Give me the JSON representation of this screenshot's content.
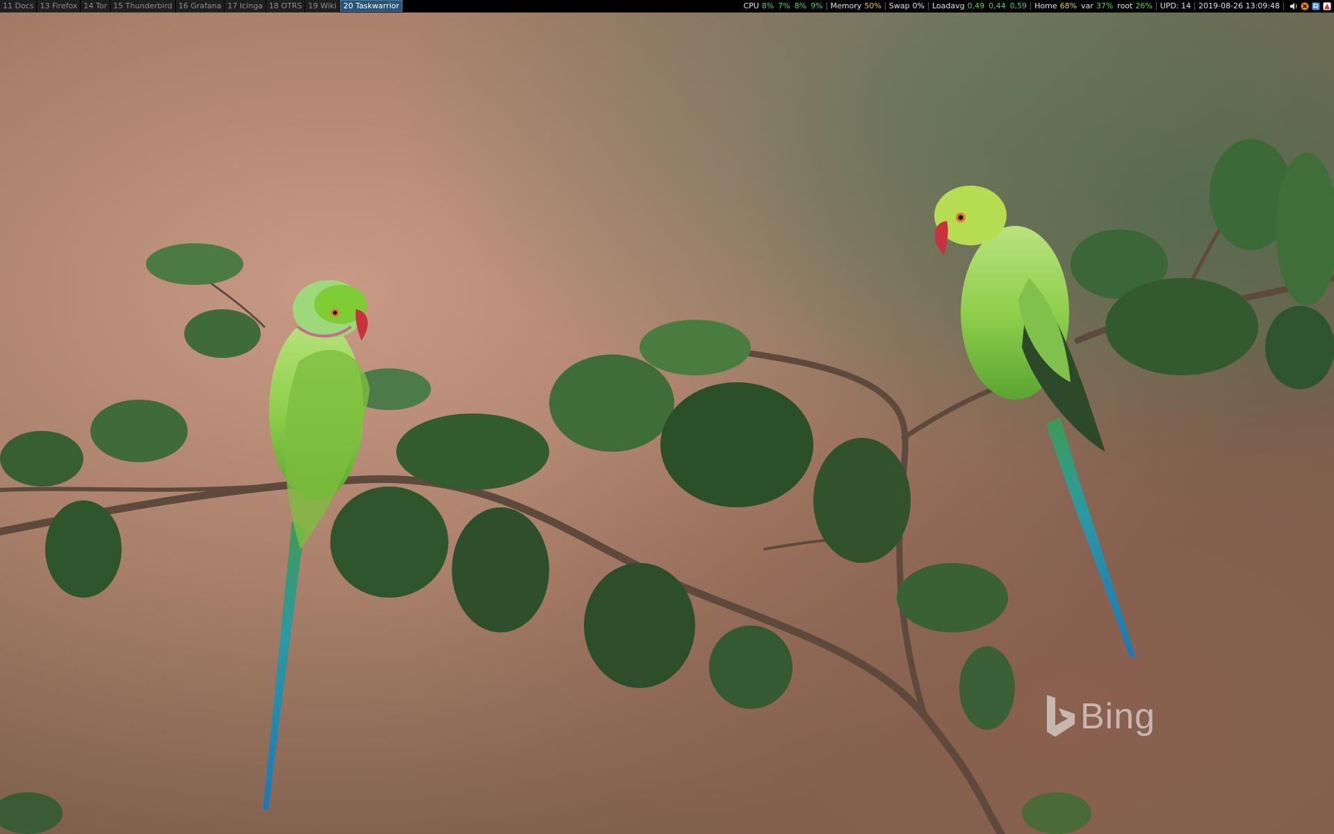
{
  "workspaces": [
    {
      "label": "11 Docs",
      "active": false
    },
    {
      "label": "13 Firefox",
      "active": false
    },
    {
      "label": "14 Tor",
      "active": false
    },
    {
      "label": "15 Thunderbird",
      "active": false
    },
    {
      "label": "16 Grafana",
      "active": false
    },
    {
      "label": "17 Icinga",
      "active": false
    },
    {
      "label": "18 OTRS",
      "active": false
    },
    {
      "label": "19 Wiki",
      "active": false
    },
    {
      "label": "20 Taskwarrior",
      "active": true
    }
  ],
  "status": {
    "cpu": {
      "label": "CPU",
      "values": [
        "8%",
        "7%",
        "8%",
        "9%"
      ]
    },
    "memory": {
      "label": "Memory",
      "value": "50%"
    },
    "swap": {
      "label": "Swap",
      "value": "0%"
    },
    "loadavg": {
      "label": "Loadavg",
      "values": [
        "0,49",
        "0,44",
        "0,59"
      ]
    },
    "disk": {
      "home_label": "Home",
      "home_value": "68%",
      "var_label": "var",
      "var_value": "37%",
      "root_label": "root",
      "root_value": "26%"
    },
    "updates": "UPD: 14",
    "datetime": "2019-08-26 13:09:48"
  },
  "tray_icons": [
    "volume-icon",
    "network-error-icon",
    "update-notifier-icon",
    "app-icon"
  ],
  "wallpaper": {
    "watermark": "Bing"
  },
  "colors": {
    "bar_bg": "#000000",
    "active_ws_bg": "#285577",
    "status_green": "#4fd44f",
    "status_yellow": "#e6d23c"
  }
}
